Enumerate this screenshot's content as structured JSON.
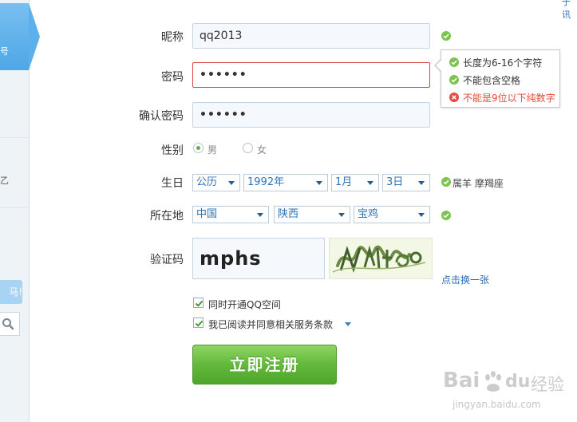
{
  "sidebar": {
    "tab_text": "号",
    "fragment_text": "乙",
    "banner_text": "马!",
    "search_icon": "search-icon"
  },
  "topright_fragment": "于讯",
  "form": {
    "nickname": {
      "label": "昵称",
      "value": "qq2013",
      "status": "ok"
    },
    "password": {
      "label": "密码",
      "value": "••••••",
      "focused": true
    },
    "password_tip": {
      "rules": [
        {
          "text": "长度为6-16个字符",
          "status": "ok"
        },
        {
          "text": "不能包含空格",
          "status": "ok"
        },
        {
          "text": "不能是9位以下纯数字",
          "status": "error"
        }
      ]
    },
    "confirm": {
      "label": "确认密码",
      "value": "••••••"
    },
    "gender": {
      "label": "性别",
      "options": [
        {
          "label": "男",
          "selected": true
        },
        {
          "label": "女",
          "selected": false
        }
      ]
    },
    "birthday": {
      "label": "生日",
      "calendar": "公历",
      "year": "1992年",
      "month": "1月",
      "day": "3日",
      "zodiac": "属羊  摩羯座"
    },
    "location": {
      "label": "所在地",
      "country": "中国",
      "province": "陕西",
      "city": "宝鸡"
    },
    "captcha": {
      "label": "验证码",
      "value": "mphs",
      "refresh_label": "点击换一张"
    },
    "checkboxes": [
      {
        "label": "同时开通QQ空间",
        "checked": true
      },
      {
        "label": "我已阅读并同意相关服务条款",
        "checked": true
      }
    ],
    "submit_label": "立即注册"
  },
  "watermark": {
    "brand": "Bai",
    "brand_suffix": "du",
    "product": "经验",
    "url": "jingyan.baidu.com"
  },
  "colors": {
    "ok": "#6cbf3b",
    "error": "#e04b3a",
    "accent_blue": "#2b6cb0",
    "submit_green": "#5db13a"
  }
}
